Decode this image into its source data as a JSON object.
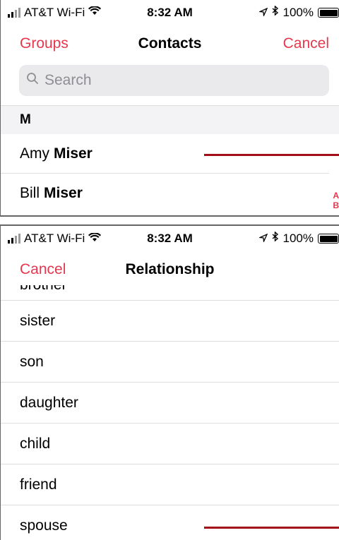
{
  "contacts_screen": {
    "status": {
      "carrier": "AT&T Wi-Fi",
      "time": "8:32 AM",
      "battery": "100%"
    },
    "nav": {
      "left": "Groups",
      "title": "Contacts",
      "right": "Cancel"
    },
    "search": {
      "placeholder": "Search"
    },
    "section_header": "M",
    "contacts": [
      {
        "first": "Amy",
        "last": "Miser"
      },
      {
        "first": "Bill",
        "last": "Miser"
      }
    ],
    "index_letters": [
      "A",
      "B"
    ]
  },
  "relationship_screen": {
    "status": {
      "carrier": "AT&T Wi-Fi",
      "time": "8:32 AM",
      "battery": "100%"
    },
    "nav": {
      "left": "Cancel",
      "title": "Relationship"
    },
    "partial_item": "brother",
    "items": [
      "sister",
      "son",
      "daughter",
      "child",
      "friend",
      "spouse"
    ]
  },
  "colors": {
    "accent": "#e5384e",
    "callout": "#a30d18"
  }
}
